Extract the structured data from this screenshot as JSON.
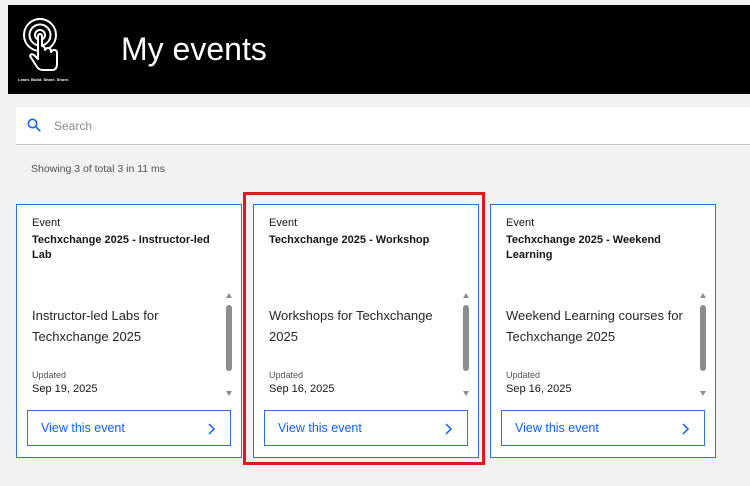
{
  "header": {
    "title": "My events",
    "logo_tagline": "Learn. Build. Share. Shore.",
    "icon": "touch-target-icon"
  },
  "search": {
    "placeholder": "Search",
    "value": "",
    "icon": "search-icon"
  },
  "results": {
    "text": "Showing 3 of total 3 in 11 ms"
  },
  "cards": [
    {
      "kind": "Event",
      "title": "Techxchange 2025 - Instructor-led Lab",
      "description": "Instructor-led Labs for Techxchange 2025",
      "updated_label": "Updated",
      "updated": "Sep 19, 2025",
      "button_label": "View this event"
    },
    {
      "kind": "Event",
      "title": "Techxchange 2025 - Workshop",
      "description": "Workshops for Techxchange 2025",
      "updated_label": "Updated",
      "updated": "Sep 16, 2025",
      "button_label": "View this event",
      "highlighted": true
    },
    {
      "kind": "Event",
      "title": "Techxchange 2025 - Weekend Learning",
      "description": "Weekend Learning courses for Techxchange 2025",
      "updated_label": "Updated",
      "updated": "Sep 16, 2025",
      "button_label": "View this event"
    }
  ],
  "colors": {
    "header_bg": "#000000",
    "accent": "#0f62fe",
    "card_border": "#2f6fe0",
    "highlight": "#e0191d",
    "page_bg": "#f2f2f2"
  }
}
